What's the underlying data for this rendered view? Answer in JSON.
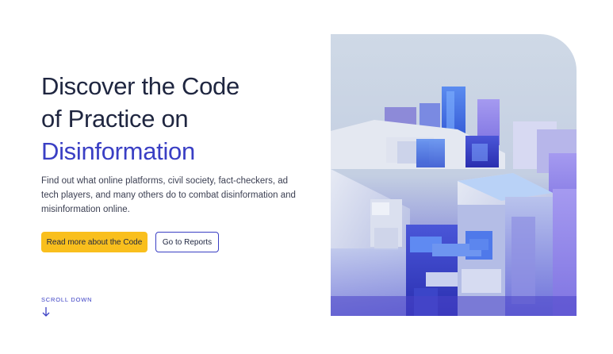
{
  "hero": {
    "title_line1": "Discover the Code",
    "title_line2": "of Practice on",
    "title_accent": "Disinformation",
    "description": "Find out what online platforms, civil society, fact-checkers, ad tech players, and many others do to combat disinformation and misinformation online.",
    "primary_button": "Read more about the Code",
    "secondary_button": "Go to Reports",
    "scroll_label": "SCROLL DOWN",
    "scroll_icon": "arrow-down-icon",
    "image_subject": "blue-cubes-illustration"
  },
  "colors": {
    "heading": "#1f2640",
    "accent": "#3a3fc4",
    "button_primary": "#f9bf1d",
    "text": "#3b3f52"
  }
}
